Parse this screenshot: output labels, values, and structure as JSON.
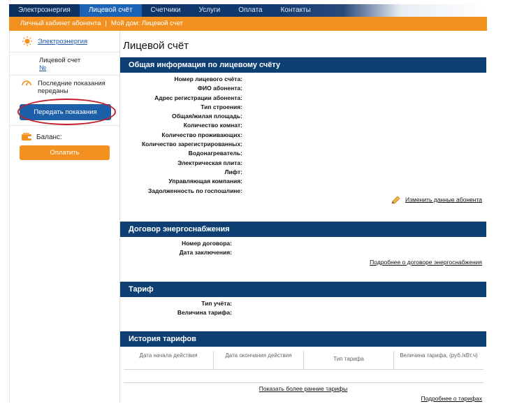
{
  "topnav": {
    "items": [
      "Электроэнергия",
      "Лицевой счёт",
      "Счетчики",
      "Услуги",
      "Оплата",
      "Контакты"
    ]
  },
  "subnav": {
    "crumb1": "Личный кабинет абонента",
    "separator": "|",
    "crumb2": "Мой дом: Лицевой счет"
  },
  "sidebar": {
    "energy_link": "Электроэнергия",
    "account_label": "Лицевой счет",
    "account_number": "№",
    "last_readings": "Последние показания переданы",
    "send_button": "Передать показания",
    "balance_label": "Баланс:",
    "pay_button": "Оплатить"
  },
  "main": {
    "title": "Лицевой счёт",
    "general": {
      "heading": "Общая информация по лицевому счёту",
      "fields": [
        "Номер лицевого счёта:",
        "ФИО абонента:",
        "Адрес регистрации абонента:",
        "Тип строения:",
        "Общая/жилая площадь:",
        "Количество комнат:",
        "Количество проживающих:",
        "Количество зарегистрированных:",
        "Водонагреватель:",
        "Электрическая плита:",
        "Лифт:",
        "Управляющая компания:",
        "Задолженность по госпошлине:"
      ],
      "edit_link": "Изменить данные абонента"
    },
    "contract": {
      "heading": "Договор энергоснабжения",
      "fields": [
        "Номер договора:",
        "Дата заключения:"
      ],
      "details_link": "Подробнее о договоре энергоснабжения"
    },
    "tariff": {
      "heading": "Тариф",
      "fields": [
        "Тип учёта:",
        "Величина тарифа:"
      ]
    },
    "history": {
      "heading": "История тарифов",
      "columns": [
        "Дата начала действия",
        "Дата окончания действия",
        "Тип тарифа",
        "Величина тарифа, (руб./кВт.ч)"
      ],
      "more_link": "Показать более ранние тарифы",
      "details_link": "Подробнее о тарифах"
    }
  },
  "colors": {
    "nav_dark": "#0d2f5e",
    "nav_active": "#1b63b6",
    "orange": "#f2911f",
    "section_header": "#0d3f73",
    "highlight_ring": "#c4202a"
  }
}
